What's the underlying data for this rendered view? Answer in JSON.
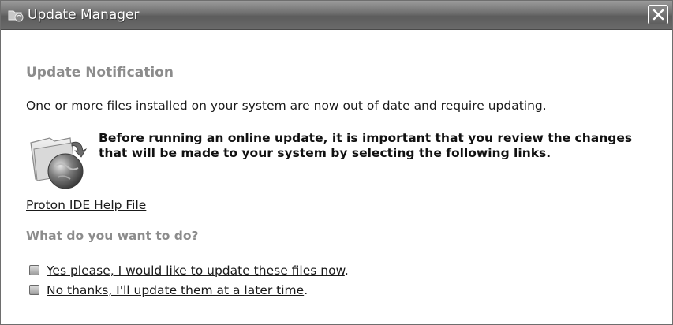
{
  "window": {
    "title": "Update Manager"
  },
  "content": {
    "heading": "Update Notification",
    "intro": "One or more files installed on your system are now out of date and require updating.",
    "warning": "Before running an online update, it is important that you review the changes that will be made to your system by selecting the following links.",
    "help_link": "Proton IDE Help File",
    "question": "What do you want to do?",
    "options": [
      {
        "label": "Yes please, I would like to update these files now",
        "suffix": "."
      },
      {
        "label": "No thanks, I'll update them at a later time",
        "suffix": "."
      }
    ]
  },
  "icons": {
    "title": "update-manager-icon",
    "close": "close-icon",
    "main": "folder-globe-icon",
    "bullet": "bullet-square-icon"
  }
}
